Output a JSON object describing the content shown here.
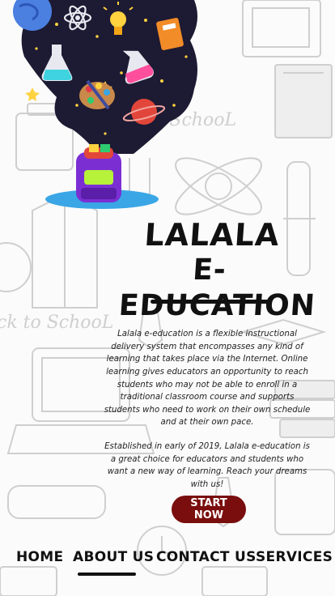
{
  "brand": {
    "line1": "LALALA",
    "line2": "E-EDUCATION"
  },
  "background": {
    "doodle_text_top": "k to SchooL",
    "doodle_text_left": "ck to SchooL"
  },
  "description": {
    "paragraph1": "Lalala e-education is a flexible instructional delivery system that encompasses any kind of learning that takes place via the Internet. Online learning gives educators an opportunity to reach students who may not be able to enroll in a traditional classroom course and supports students who need to work on their own schedule and at their own pace.",
    "paragraph2": "Established in early of 2019, Lalala e-education is a great choice for educators and students who want a new way of learning. Reach your dreams with us!"
  },
  "cta": {
    "label": "START NOW",
    "color": "#7a0d0d"
  },
  "nav": {
    "items": [
      {
        "label": "HOME"
      },
      {
        "label": "ABOUT US",
        "active": true
      },
      {
        "label": "CONTACT US"
      },
      {
        "label": "SERVICES"
      }
    ]
  },
  "colors": {
    "hero_night": "#1d1a33",
    "backpack": "#7b2fd3",
    "accent_blue": "#3aa6e6"
  }
}
